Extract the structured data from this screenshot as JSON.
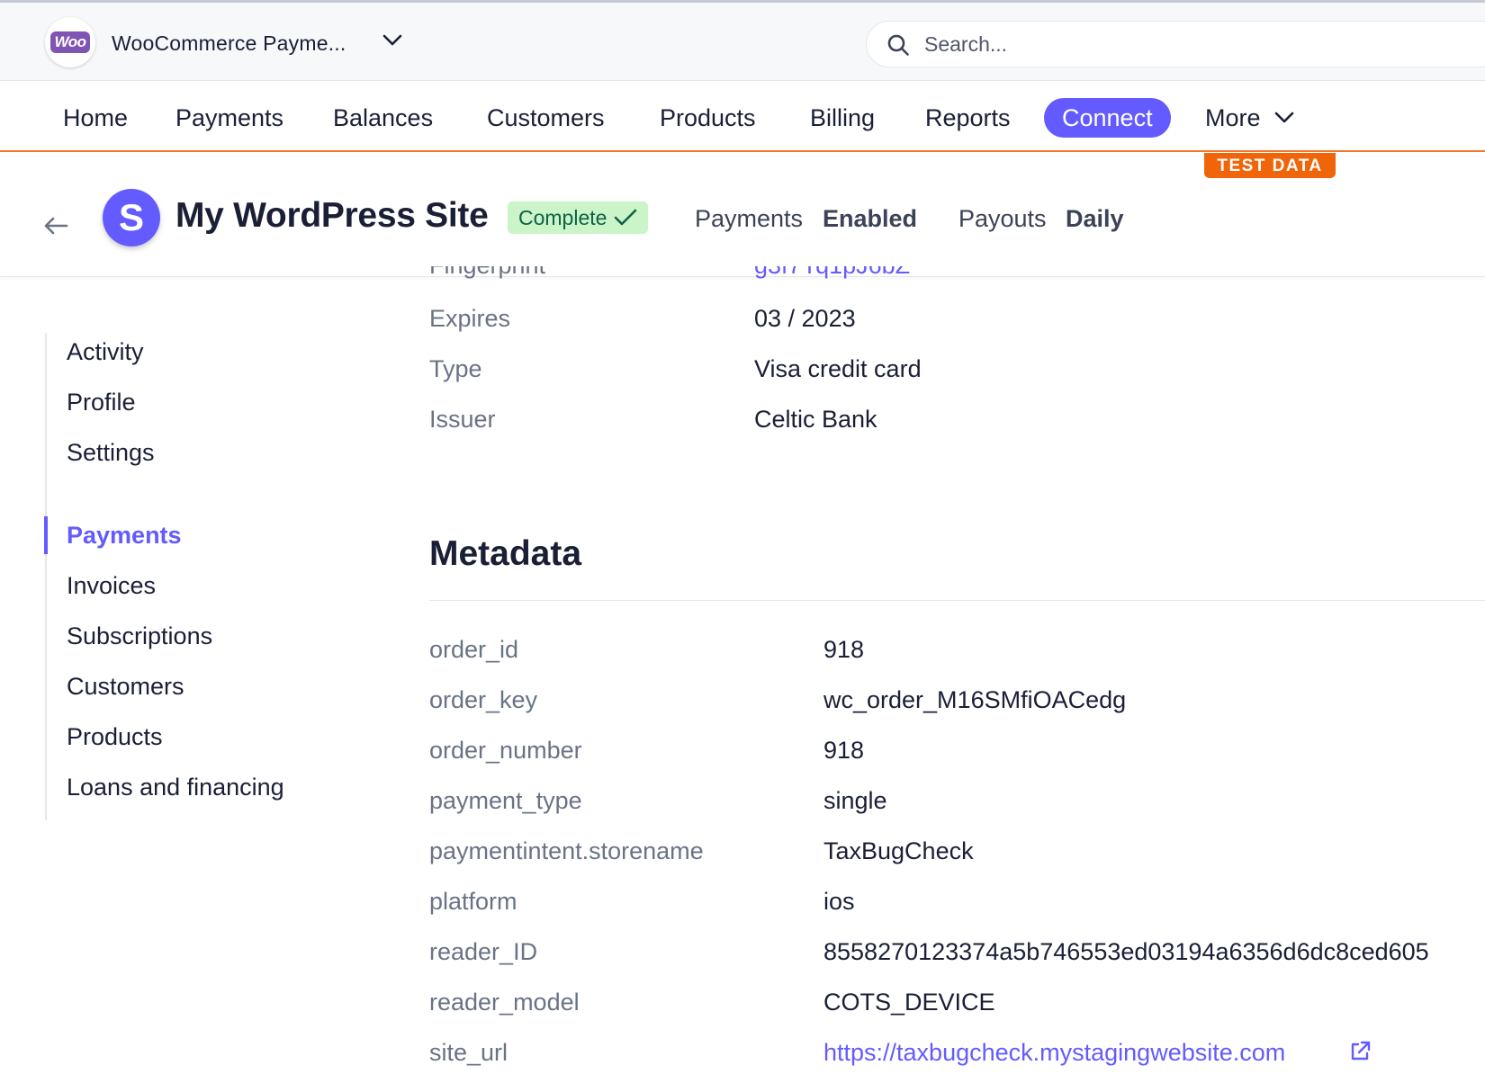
{
  "topbar": {
    "account_logo_text": "Woo",
    "account_name": "WooCommerce Payme...",
    "search_placeholder": "Search..."
  },
  "nav": {
    "items": [
      {
        "label": "Home"
      },
      {
        "label": "Payments"
      },
      {
        "label": "Balances"
      },
      {
        "label": "Customers"
      },
      {
        "label": "Products"
      },
      {
        "label": "Billing"
      },
      {
        "label": "Reports"
      },
      {
        "label": "Connect",
        "active": true
      },
      {
        "label": "More"
      }
    ],
    "test_badge": "TEST DATA"
  },
  "header": {
    "avatar_letter": "S",
    "title": "My WordPress Site",
    "status": "Complete",
    "payments_label": "Payments",
    "payments_value": "Enabled",
    "payouts_label": "Payouts",
    "payouts_value": "Daily"
  },
  "sidebar": {
    "group1": [
      {
        "label": "Activity"
      },
      {
        "label": "Profile"
      },
      {
        "label": "Settings"
      }
    ],
    "group2": [
      {
        "label": "Payments",
        "active": true
      },
      {
        "label": "Invoices"
      },
      {
        "label": "Subscriptions"
      },
      {
        "label": "Customers"
      },
      {
        "label": "Products"
      },
      {
        "label": "Loans and financing"
      }
    ]
  },
  "card_details": [
    {
      "label": "Expires",
      "value": "03 / 2023"
    },
    {
      "label": "Type",
      "value": "Visa credit card"
    },
    {
      "label": "Issuer",
      "value": "Celtic Bank"
    }
  ],
  "metadata": {
    "title": "Metadata",
    "rows": [
      {
        "key": "order_id",
        "value": "918"
      },
      {
        "key": "order_key",
        "value": "wc_order_M16SMfiOACedg"
      },
      {
        "key": "order_number",
        "value": "918"
      },
      {
        "key": "payment_type",
        "value": "single"
      },
      {
        "key": "paymentintent.storename",
        "value": "TaxBugCheck"
      },
      {
        "key": "platform",
        "value": "ios"
      },
      {
        "key": "reader_ID",
        "value": "8558270123374a5b746553ed03194a6356d6dc8ced605"
      },
      {
        "key": "reader_model",
        "value": "COTS_DEVICE"
      },
      {
        "key": "site_url",
        "value": "https://taxbugcheck.mystagingwebsite.com"
      }
    ]
  },
  "colors": {
    "accent": "#635bff",
    "test_badge": "#f0650a",
    "status_bg": "#cbf4c9",
    "status_text": "#0e6245"
  }
}
